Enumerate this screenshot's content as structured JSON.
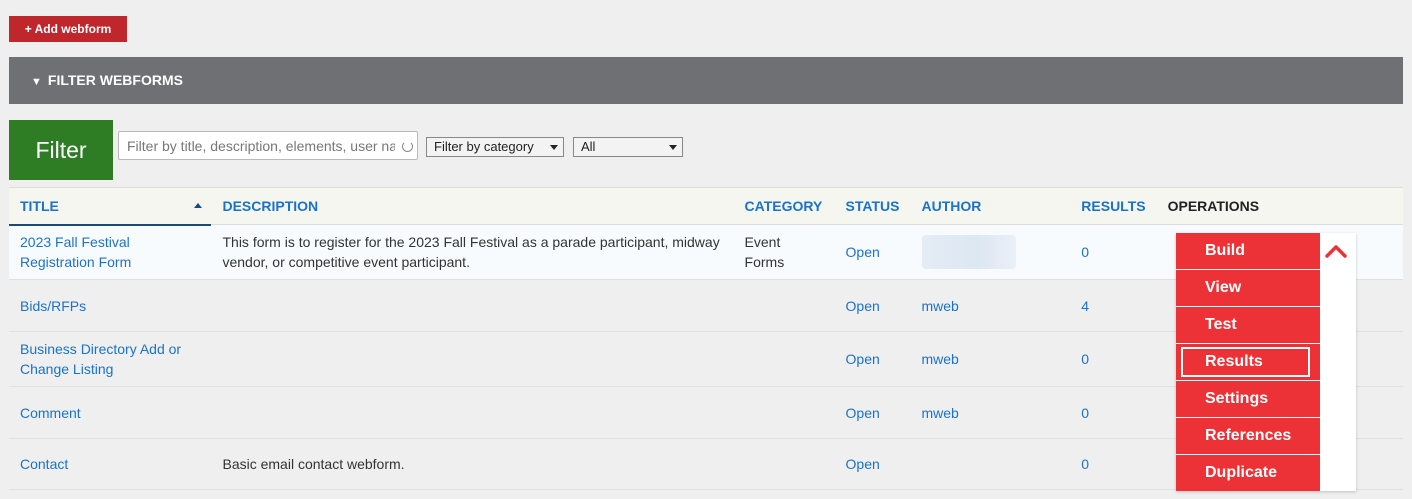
{
  "toolbar": {
    "add_label": "+ Add webform"
  },
  "filter_section": {
    "label": "FILTER WEBFORMS"
  },
  "filters": {
    "submit_label": "Filter",
    "search_placeholder": "Filter by title, description, elements, user name, or role",
    "category_value": "Filter by category",
    "state_value": "All"
  },
  "table": {
    "headers": {
      "title": "TITLE",
      "description": "DESCRIPTION",
      "category": "CATEGORY",
      "status": "STATUS",
      "author": "AUTHOR",
      "results": "RESULTS",
      "operations": "OPERATIONS"
    },
    "rows": [
      {
        "title": "2023 Fall Festival Registration Form",
        "description": "This form is to register for the 2023 Fall Festival as a parade participant, midway vendor, or competitive event participant.",
        "category": "Event Forms",
        "status": "Open",
        "author": "",
        "results": "0"
      },
      {
        "title": "Bids/RFPs",
        "description": "",
        "category": "",
        "status": "Open",
        "author": "mweb",
        "results": "4"
      },
      {
        "title": "Business Directory Add or Change Listing",
        "description": "",
        "category": "",
        "status": "Open",
        "author": "mweb",
        "results": "0"
      },
      {
        "title": "Comment",
        "description": "",
        "category": "",
        "status": "Open",
        "author": "mweb",
        "results": "0"
      },
      {
        "title": "Contact",
        "description": "Basic email contact webform.",
        "category": "",
        "status": "Open",
        "author": "",
        "results": "0"
      }
    ]
  },
  "operations_menu": {
    "items": [
      "Build",
      "View",
      "Test",
      "Results",
      "Settings",
      "References",
      "Duplicate"
    ],
    "focused": "Results"
  },
  "colors": {
    "accent_red": "#c0272d",
    "menu_red": "#ec3236",
    "filter_green": "#2e7d25",
    "link_blue": "#1a73c8"
  }
}
